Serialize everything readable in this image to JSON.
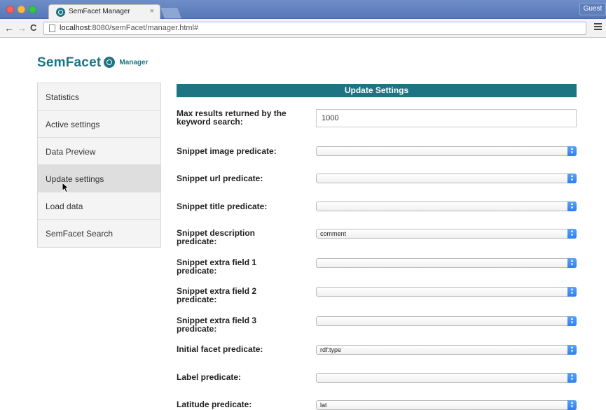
{
  "browser": {
    "tab_title": "SemFacet Manager",
    "tab_close": "×",
    "guest_label": "Guest",
    "url_host": "localhost",
    "url_path": ":8080/semFacet/manager.html#"
  },
  "brand": {
    "name": "SemFacet",
    "subtitle": "Manager",
    "color": "#1f7484"
  },
  "sidebar": {
    "items": [
      {
        "label": "Statistics"
      },
      {
        "label": "Active settings"
      },
      {
        "label": "Data Preview"
      },
      {
        "label": "Update settings"
      },
      {
        "label": "Load data"
      },
      {
        "label": "SemFacet Search"
      }
    ],
    "active_index": 3
  },
  "panel": {
    "title": "Update Settings",
    "fields": [
      {
        "label": "Max results returned by the keyword search:",
        "type": "text",
        "value": "1000"
      },
      {
        "label": "Snippet image predicate:",
        "type": "select",
        "value": ""
      },
      {
        "label": "Snippet url predicate:",
        "type": "select",
        "value": ""
      },
      {
        "label": "Snippet title predicate:",
        "type": "select",
        "value": ""
      },
      {
        "label": "Snippet description predicate:",
        "type": "select",
        "value": "comment"
      },
      {
        "label": "Snippet extra field 1 predicate:",
        "type": "select",
        "value": ""
      },
      {
        "label": "Snippet extra field 2 predicate:",
        "type": "select",
        "value": ""
      },
      {
        "label": "Snippet extra field 3 predicate:",
        "type": "select",
        "value": ""
      },
      {
        "label": "Initial facet predicate:",
        "type": "select",
        "value": "rdf:type"
      },
      {
        "label": "Label predicate:",
        "type": "select",
        "value": ""
      },
      {
        "label": "Latitude predicate:",
        "type": "select",
        "value": "lat"
      }
    ]
  }
}
